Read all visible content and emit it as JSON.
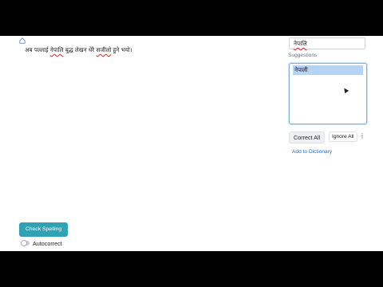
{
  "editor": {
    "words": [
      {
        "text": "अब ",
        "misspelled": false
      },
      {
        "text": "पल्लाई ",
        "misspelled": false
      },
      {
        "text": "नेपालि",
        "misspelled": true
      },
      {
        "text": " बुद्ध लेखन धेरै ",
        "misspelled": false
      },
      {
        "text": "सजीलो",
        "misspelled": true
      },
      {
        "text": " हुने भयो।",
        "misspelled": false
      }
    ]
  },
  "panel": {
    "current_word": "नेपालि",
    "suggestions_title": "Suggestions",
    "suggestions": [
      "नेपाली"
    ],
    "correct_all_label": "Correct All",
    "ignore_all_label": "Ignore All",
    "more_icon": "more-vertical-icon",
    "add_dictionary_label": "Add to Dictionary"
  },
  "footer": {
    "check_spelling_label": "Check Spelling",
    "autocorrect_label": "Autocorrect",
    "autocorrect_on": false
  },
  "colors": {
    "accent": "#2fa3b3",
    "selection": "#b7d3f4",
    "link": "#1a6fd6",
    "error_underline": "#d0312d"
  }
}
